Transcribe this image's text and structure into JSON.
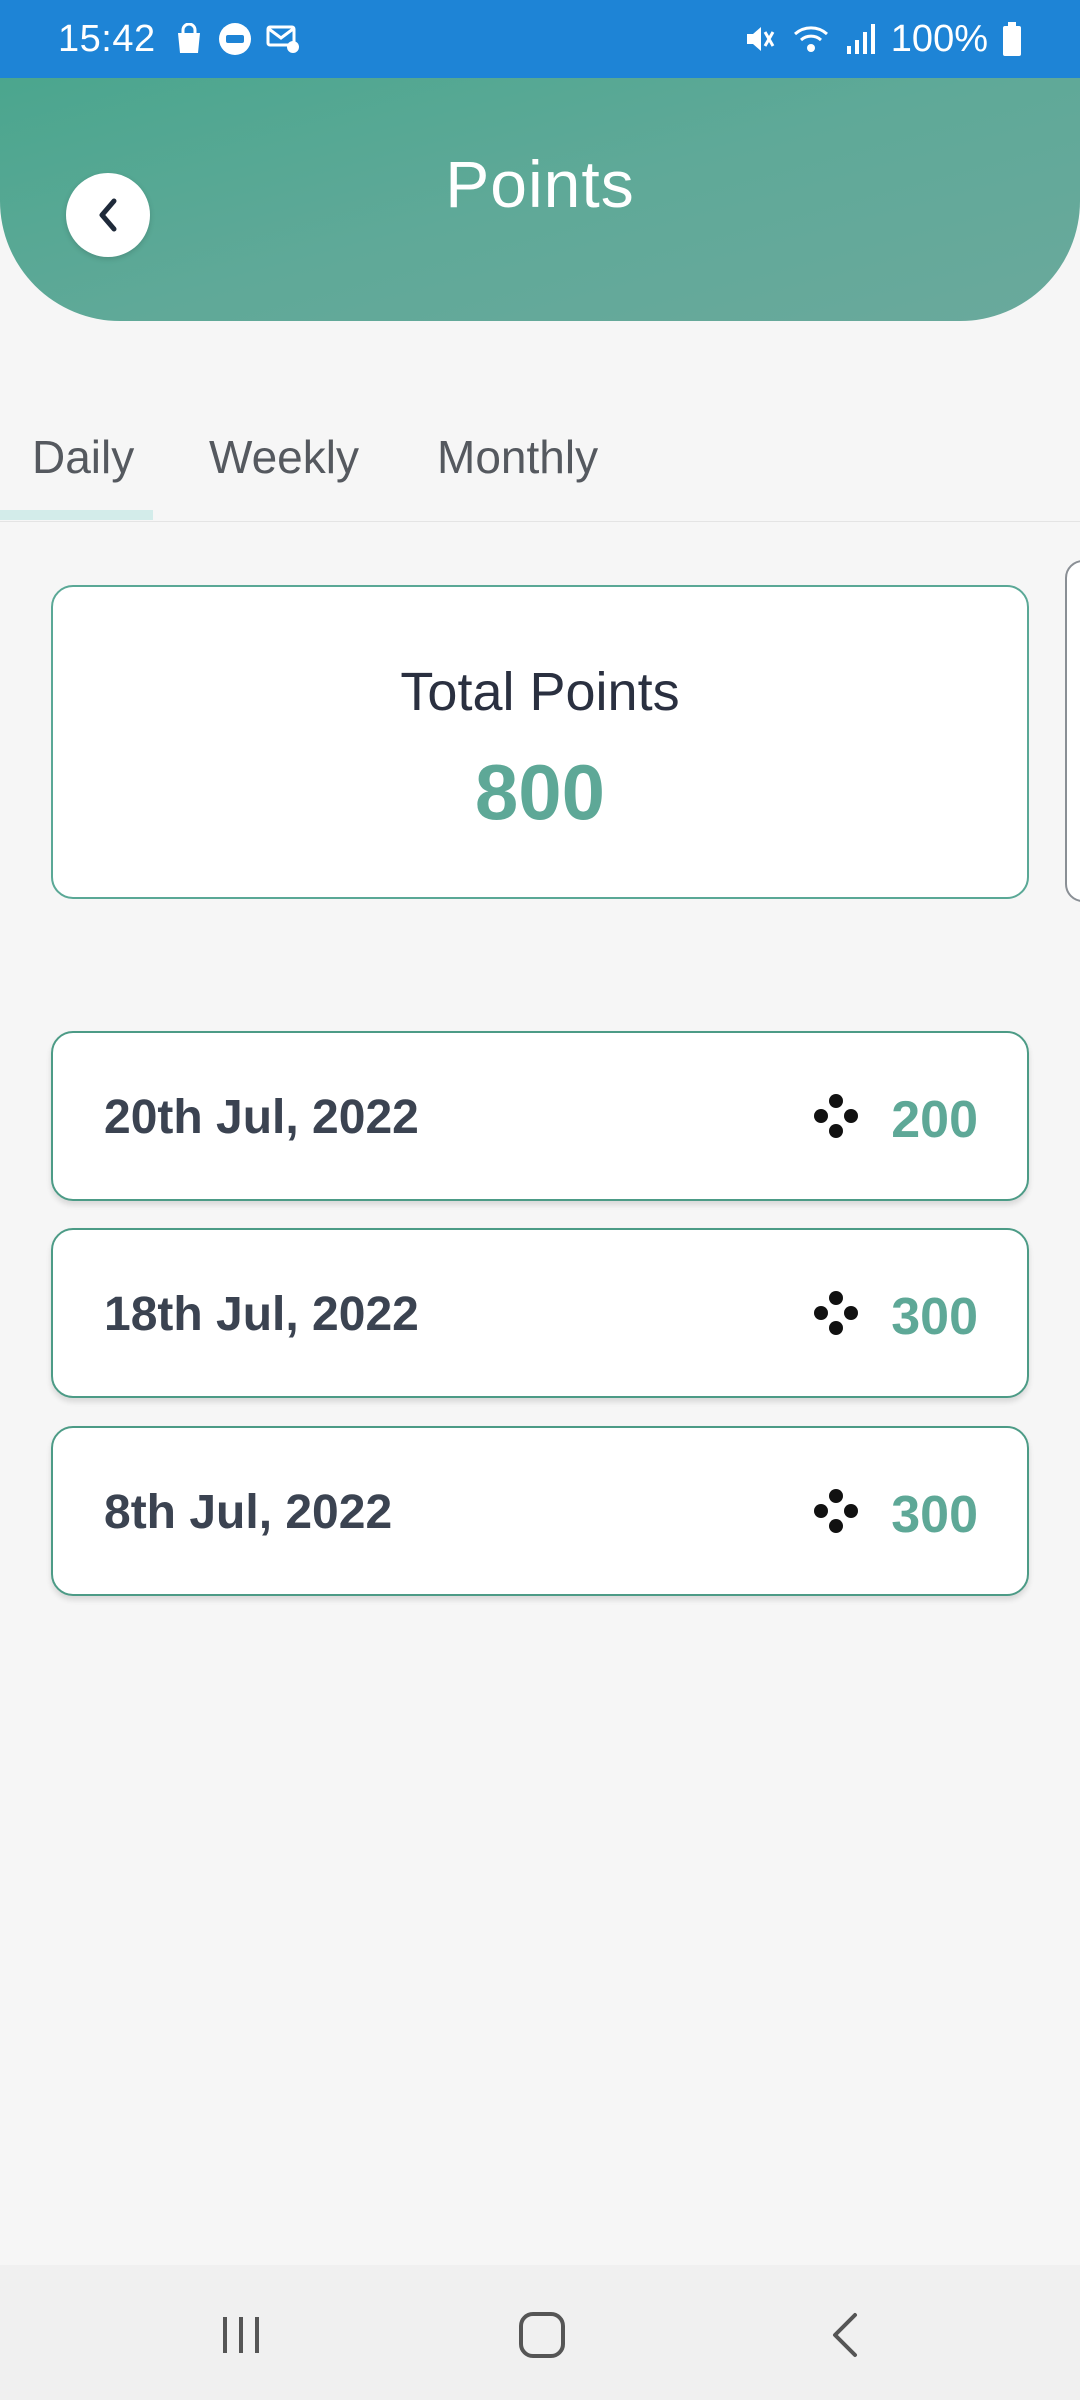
{
  "status_bar": {
    "time": "15:42",
    "left_icons": [
      "shopping-bag-icon",
      "pay-icon",
      "mail-settings-icon"
    ],
    "right_icons": [
      "mute-icon",
      "wifi-icon",
      "signal-icon",
      "battery-icon"
    ],
    "battery": "100%"
  },
  "header": {
    "title": "Points",
    "back_icon": "chevron-left-icon",
    "gradient": [
      "#4ba68e",
      "#6aa99c"
    ]
  },
  "tabs": [
    {
      "label": "Daily",
      "selected": true
    },
    {
      "label": "Weekly",
      "selected": false
    },
    {
      "label": "Monthly",
      "selected": false
    }
  ],
  "summary": {
    "label": "Total Points",
    "value": "800"
  },
  "entries": [
    {
      "date": "20th Jul, 2022",
      "points": "200",
      "icon": "points-cluster-icon"
    },
    {
      "date": "18th Jul, 2022",
      "points": "300",
      "icon": "points-cluster-icon"
    },
    {
      "date": "8th Jul, 2022",
      "points": "300",
      "icon": "points-cluster-icon"
    }
  ],
  "nav_bar": {
    "buttons": [
      "recent-apps-icon",
      "home-icon",
      "back-icon"
    ]
  },
  "colors": {
    "status_bar": "#1e84d6",
    "accent": "#5ea897",
    "text_dark": "#3b4351"
  }
}
